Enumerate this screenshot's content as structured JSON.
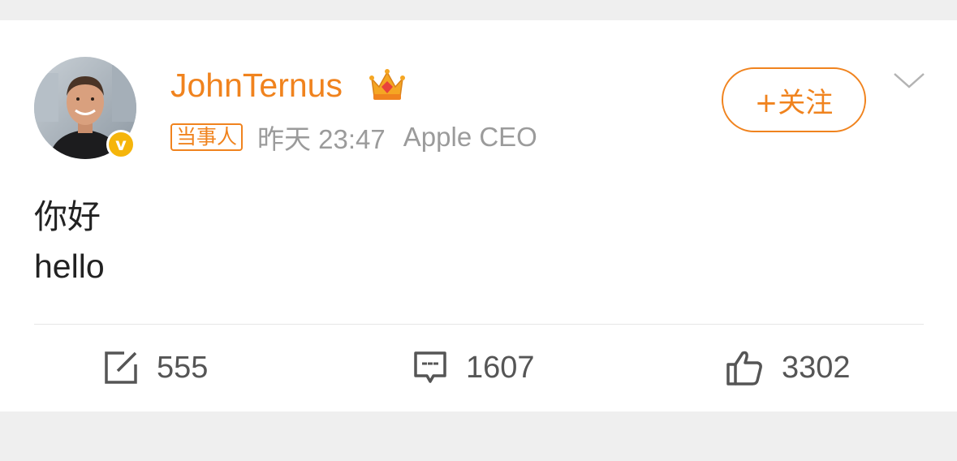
{
  "post": {
    "username": "JohnTernus",
    "tag": "当事人",
    "time": "昨天 23:47",
    "source": "Apple CEO",
    "follow_label": "+关注",
    "content_lines": [
      "你好",
      "hello"
    ]
  },
  "actions": {
    "repost_count": "555",
    "comment_count": "1607",
    "like_count": "3302"
  },
  "icons": {
    "verified": "verified-v-badge",
    "crown": "crown-icon",
    "more": "chevron-down-icon",
    "repost": "share-icon",
    "comment": "comment-icon",
    "like": "thumbs-up-icon"
  },
  "colors": {
    "accent": "#f0831e",
    "badge": "#f5b50b",
    "secondary_text": "#9b9b9b"
  }
}
